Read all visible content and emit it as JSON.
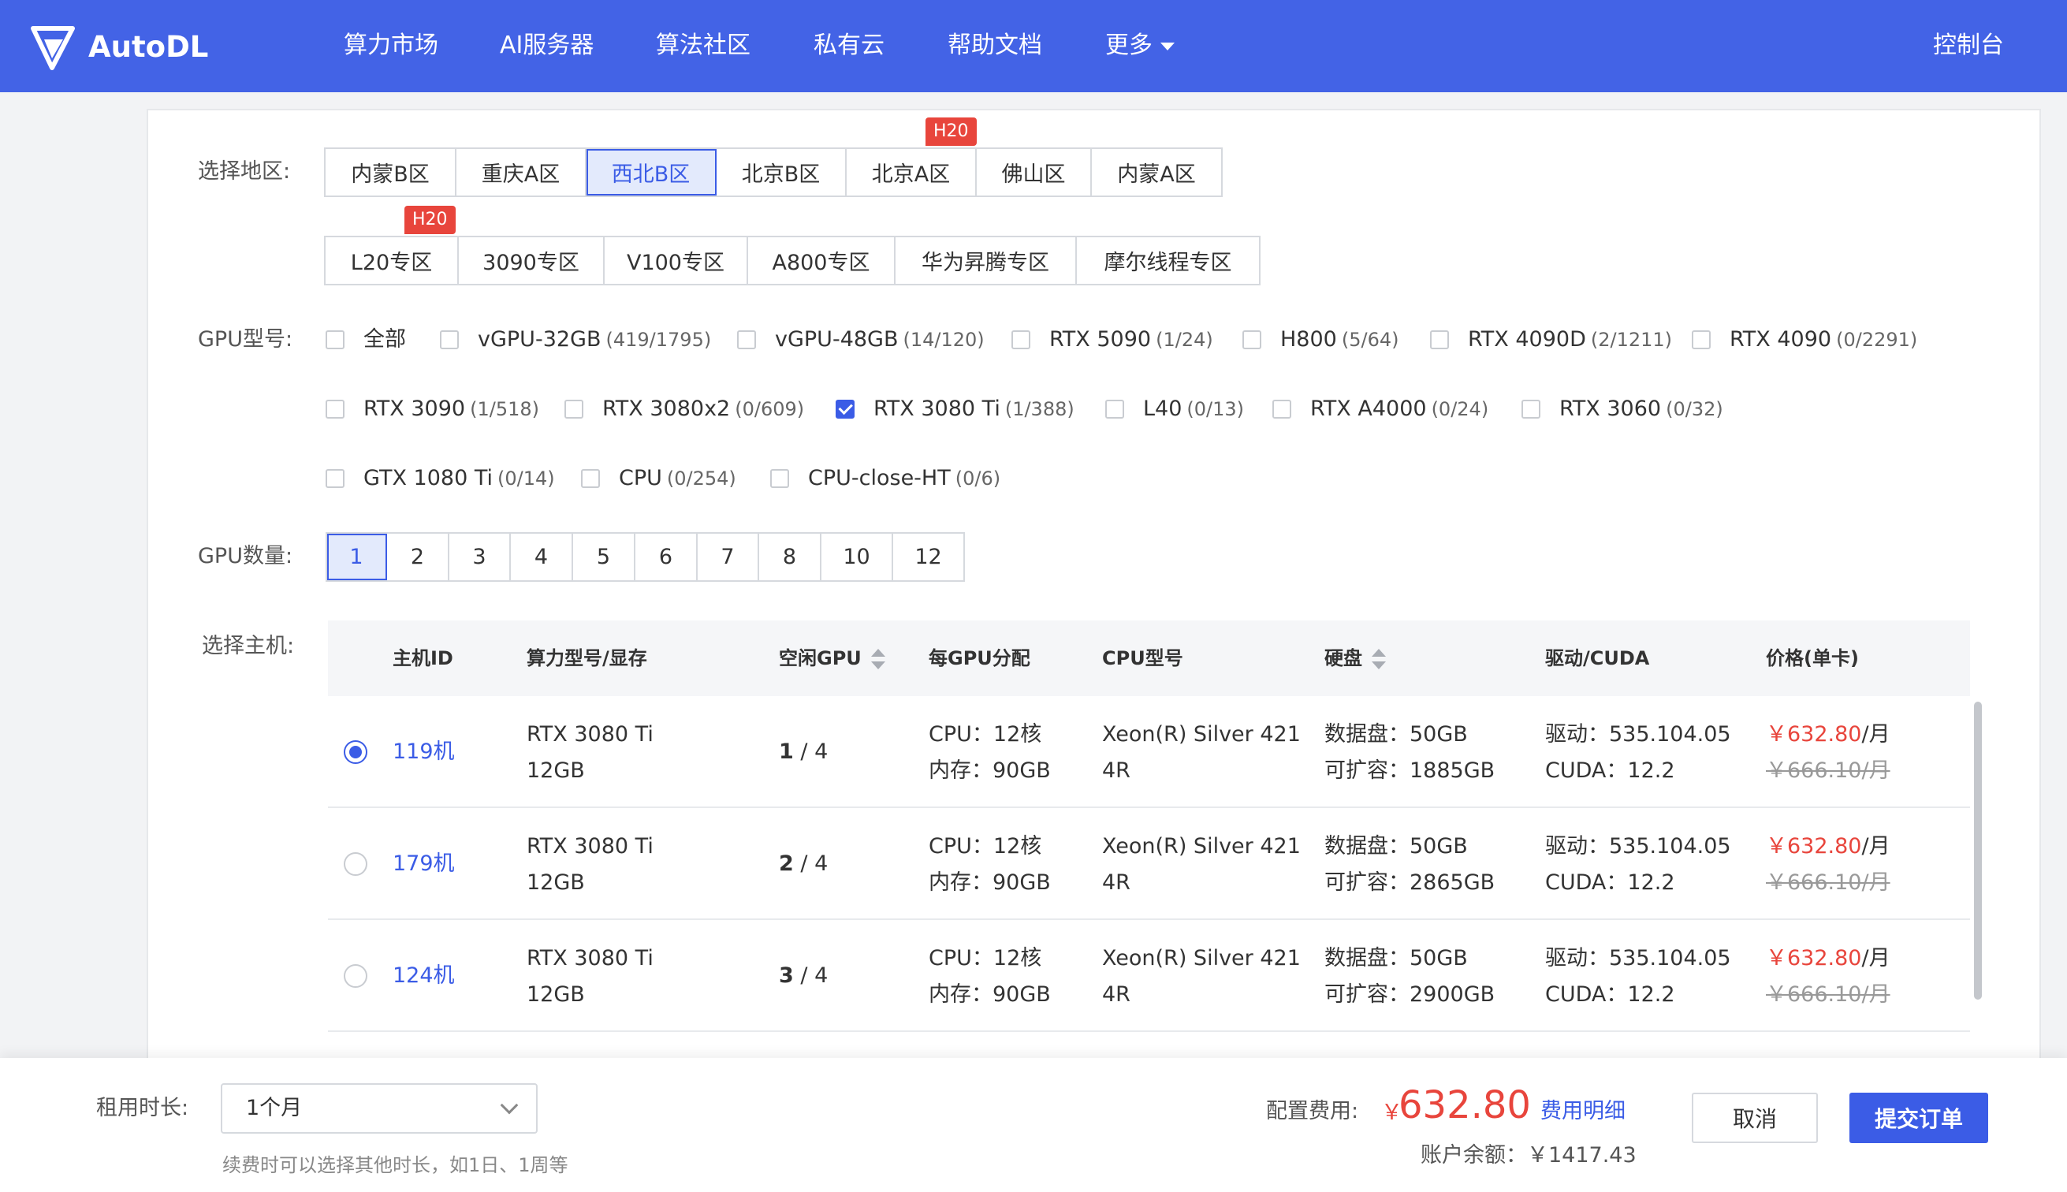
{
  "nav": {
    "logo_text": "AutoDL",
    "items": [
      "算力市场",
      "AI服务器",
      "算法社区",
      "私有云",
      "帮助文档",
      "更多"
    ],
    "console": "控制台"
  },
  "region": {
    "label": "选择地区:",
    "row1": [
      "内蒙B区",
      "重庆A区",
      "西北B区",
      "北京B区",
      "北京A区",
      "佛山区",
      "内蒙A区"
    ],
    "row2": [
      "L20专区",
      "3090专区",
      "V100专区",
      "A800专区",
      "华为昇腾专区",
      "摩尔线程专区"
    ],
    "selected": "西北B区",
    "badge_beijing_a": "H20",
    "badge_l20": "H20"
  },
  "gpu_type": {
    "label": "GPU型号:",
    "options": [
      {
        "name": "全部",
        "count": ""
      },
      {
        "name": "vGPU-32GB",
        "count": "(419/1795)"
      },
      {
        "name": "vGPU-48GB",
        "count": "(14/120)"
      },
      {
        "name": "RTX 5090",
        "count": "(1/24)"
      },
      {
        "name": "H800",
        "count": "(5/64)"
      },
      {
        "name": "RTX 4090D",
        "count": "(2/1211)"
      },
      {
        "name": "RTX 4090",
        "count": "(0/2291)"
      },
      {
        "name": "RTX 3090",
        "count": "(1/518)"
      },
      {
        "name": "RTX 3080x2",
        "count": "(0/609)"
      },
      {
        "name": "RTX 3080 Ti",
        "count": "(1/388)"
      },
      {
        "name": "L40",
        "count": "(0/13)"
      },
      {
        "name": "RTX A4000",
        "count": "(0/24)"
      },
      {
        "name": "RTX 3060",
        "count": "(0/32)"
      },
      {
        "name": "GTX 1080 Ti",
        "count": "(0/14)"
      },
      {
        "name": "CPU",
        "count": "(0/254)"
      },
      {
        "name": "CPU-close-HT",
        "count": "(0/6)"
      }
    ],
    "checked": "RTX 3080 Ti"
  },
  "gpu_count": {
    "label": "GPU数量:",
    "options": [
      "1",
      "2",
      "3",
      "4",
      "5",
      "6",
      "7",
      "8",
      "10",
      "12"
    ],
    "selected": "1"
  },
  "host": {
    "label": "选择主机:",
    "columns": [
      "主机ID",
      "算力型号/显存",
      "空闲GPU",
      "每GPU分配",
      "CPU型号",
      "硬盘",
      "驱动/CUDA",
      "价格(单卡)"
    ],
    "rows": [
      {
        "id": "119机",
        "model": "RTX 3080 Ti",
        "vram": "12GB",
        "free": "1",
        "total": "/ 4",
        "cpu": "CPU：12核",
        "mem": "内存：90GB",
        "cpu_model_1": "Xeon(R) Silver 421",
        "cpu_model_2": "4R",
        "disk": "数据盘：50GB",
        "expand": "可扩容：1885GB",
        "driver": "驱动：535.104.05",
        "cuda": "CUDA：12.2",
        "price": "￥632.80",
        "unit": "/月",
        "orig_price": "￥666.10/月"
      },
      {
        "id": "179机",
        "model": "RTX 3080 Ti",
        "vram": "12GB",
        "free": "2",
        "total": "/ 4",
        "cpu": "CPU：12核",
        "mem": "内存：90GB",
        "cpu_model_1": "Xeon(R) Silver 421",
        "cpu_model_2": "4R",
        "disk": "数据盘：50GB",
        "expand": "可扩容：2865GB",
        "driver": "驱动：535.104.05",
        "cuda": "CUDA：12.2",
        "price": "￥632.80",
        "unit": "/月",
        "orig_price": "￥666.10/月"
      },
      {
        "id": "124机",
        "model": "RTX 3080 Ti",
        "vram": "12GB",
        "free": "3",
        "total": "/ 4",
        "cpu": "CPU：12核",
        "mem": "内存：90GB",
        "cpu_model_1": "Xeon(R) Silver 421",
        "cpu_model_2": "4R",
        "disk": "数据盘：50GB",
        "expand": "可扩容：2900GB",
        "driver": "驱动：535.104.05",
        "cuda": "CUDA：12.2",
        "price": "￥632.80",
        "unit": "/月",
        "orig_price": "￥666.10/月"
      }
    ]
  },
  "footer": {
    "duration_label": "租用时长:",
    "duration_value": "1个月",
    "hint": "续费时可以选择其他时长，如1日、1周等",
    "cost_label": "配置费用:",
    "cost_currency": "￥",
    "cost_value": "632.80",
    "cost_detail": "费用明细",
    "balance": "账户余额：￥1417.43",
    "cancel": "取消",
    "submit": "提交订单"
  },
  "colors": {
    "primary": "#3b5ce6",
    "nav": "#4363e6",
    "red": "#e8453c"
  }
}
